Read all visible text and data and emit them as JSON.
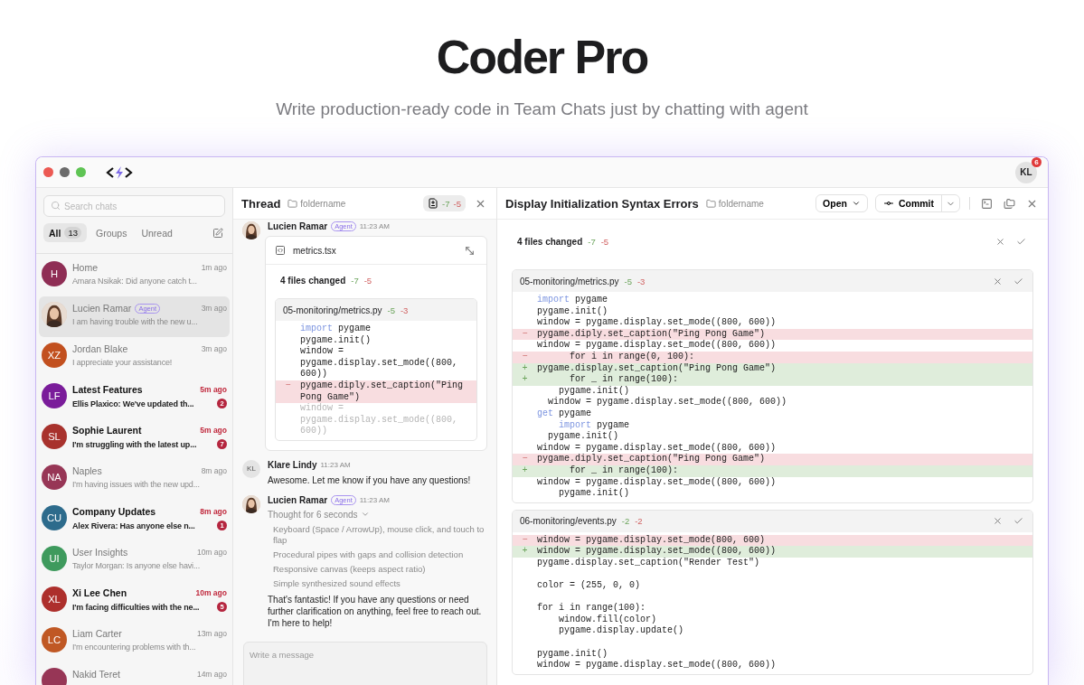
{
  "hero": {
    "title": "Coder Pro",
    "subtitle": "Write production-ready code in Team Chats just by chatting with agent"
  },
  "user": {
    "initials": "KL",
    "badge": "6"
  },
  "sidebar": {
    "search": {
      "placeholder": "Search chats"
    },
    "tabs": [
      {
        "label": "All",
        "count": "13",
        "selected": true
      },
      {
        "label": "Groups",
        "selected": false
      },
      {
        "label": "Unread",
        "selected": false
      }
    ],
    "chats": [
      {
        "name": "Home",
        "preview": "Amara Nsikak: Did anyone catch t...",
        "time": "1m ago",
        "unread": false,
        "selected": false,
        "avatar": {
          "kind": "initials",
          "initials": "H",
          "color": "#8f2e55"
        }
      },
      {
        "name": "Lucien Ramar",
        "tag": "Agent",
        "preview": "I am having trouble with the new u...",
        "time": "3m ago",
        "unread": false,
        "selected": true,
        "avatar": {
          "kind": "photo"
        }
      },
      {
        "name": "Jordan Blake",
        "preview": "I appreciate your assistance!",
        "time": "3m ago",
        "unread": false,
        "selected": false,
        "avatar": {
          "kind": "initials",
          "initials": "XZ",
          "color": "#c2501f"
        }
      },
      {
        "name": "Latest Features",
        "preview": "Ellis Plaxico: We've updated th...",
        "time": "5m ago",
        "unread": true,
        "badge": "2",
        "selected": false,
        "avatar": {
          "kind": "initials",
          "initials": "LF",
          "color": "#7a1c9a"
        }
      },
      {
        "name": "Sophie Laurent",
        "preview": "I'm struggling with the latest up...",
        "time": "5m ago",
        "unread": true,
        "badge": "7",
        "selected": false,
        "avatar": {
          "kind": "initials",
          "initials": "SL",
          "color": "#a8322d"
        }
      },
      {
        "name": "Naples",
        "preview": "I'm having issues with the new upd...",
        "time": "8m ago",
        "unread": false,
        "selected": false,
        "avatar": {
          "kind": "initials",
          "initials": "NA",
          "color": "#973656"
        }
      },
      {
        "name": "Company Updates",
        "preview": "Alex Rivera: Has anyone else n...",
        "time": "8m ago",
        "unread": true,
        "badge": "1",
        "selected": false,
        "avatar": {
          "kind": "initials",
          "initials": "CU",
          "color": "#2d6b8c"
        }
      },
      {
        "name": "User Insights",
        "preview": "Taylor Morgan: Is anyone else havi...",
        "time": "10m ago",
        "unread": false,
        "selected": false,
        "avatar": {
          "kind": "initials",
          "initials": "UI",
          "color": "#3e9a5d"
        }
      },
      {
        "name": "Xi Lee Chen",
        "preview": "I'm facing difficulties with the ne...",
        "time": "10m ago",
        "unread": true,
        "badge": "5",
        "selected": false,
        "avatar": {
          "kind": "initials",
          "initials": "XL",
          "color": "#ad2f2c"
        }
      },
      {
        "name": "Liam Carter",
        "preview": "I'm encountering problems with th...",
        "time": "13m ago",
        "unread": false,
        "selected": false,
        "avatar": {
          "kind": "initials",
          "initials": "LC",
          "color": "#c05824"
        }
      },
      {
        "name": "Nakid Teret",
        "time": "14m ago",
        "unread": false,
        "selected": false,
        "avatar": {
          "kind": "initials",
          "color": "#973656"
        }
      }
    ]
  },
  "thread": {
    "title": "Thread",
    "folder": "foldername",
    "added": "-7",
    "removed": "-5",
    "messages": [
      {
        "author": "Lucien Ramar",
        "tag": "Agent",
        "time": "11:23 AM",
        "avatar": {
          "kind": "photo"
        },
        "attachment": {
          "filename": "metrics.tsx",
          "summary": "4 files changed",
          "added": "-7",
          "removed": "-5",
          "file": {
            "path": "05-monitoring/metrics.py",
            "added": "-5",
            "removed": "-3",
            "lines": [
              {
                "kind": "context",
                "keyword": "import",
                "text": " pygame"
              },
              {
                "kind": "context",
                "text": "pygame.init()"
              },
              {
                "kind": "context",
                "text": "window = pygame.display.set_mode((800, 600))"
              },
              {
                "kind": "removed",
                "sign": "−",
                "text": "pygame.diply.set_caption(\"Ping Pong Game\")"
              },
              {
                "kind": "context",
                "text": "window = pygame.display.set_mode((800, 600))",
                "dimmed": true
              }
            ]
          }
        }
      },
      {
        "author": "Klare Lindy",
        "time": "11:23 AM",
        "avatar": {
          "kind": "initials",
          "initials": "KL",
          "color": "#e4e4e4"
        },
        "text": "Awesome. Let me know if you have any questions!"
      },
      {
        "author": "Lucien Ramar",
        "tag": "Agent",
        "time": "11:23 AM",
        "avatar": {
          "kind": "photo"
        },
        "thought": {
          "label": "Thought for 6 seconds",
          "expanded": true,
          "steps": [
            "Keyboard (Space / ArrowUp), mouse click, and touch to flap",
            "Procedural pipes with gaps and collision detection",
            "Responsive canvas (keeps aspect ratio)",
            "Simple synthesized sound effects"
          ]
        },
        "text": "That's fantastic! If you have any questions or need further clarification on anything, feel free to reach out. I'm here to help!"
      }
    ],
    "composer": {
      "placeholder": "Write a message"
    }
  },
  "review": {
    "title": "Display Initialization Syntax Errors",
    "folder": "foldername",
    "buttons": {
      "open": "Open",
      "commit": "Commit"
    },
    "summary": "4 files changed",
    "added": "-7",
    "removed": "-5",
    "files": [
      {
        "path": "05-monitoring/metrics.py",
        "added": "-5",
        "removed": "-3",
        "lines": [
          {
            "kind": "context",
            "keyword": "import",
            "text": " pygame"
          },
          {
            "kind": "context",
            "text": "pygame.init()"
          },
          {
            "kind": "context",
            "text": "window = pygame.display.set_mode((800, 600))"
          },
          {
            "kind": "removed",
            "sign": "−",
            "text": "pygame.diply.set_caption(\"Ping Pong Game\")"
          },
          {
            "kind": "context",
            "text": "window = pygame.display.set_mode((800, 600))"
          },
          {
            "kind": "removed",
            "sign": "−",
            "text": "      for i in range(0, 100):"
          },
          {
            "kind": "added",
            "sign": "+",
            "text": "pygame.display.set_caption(\"Ping Pong Game\")"
          },
          {
            "kind": "added",
            "sign": "+",
            "text": "      for _ in range(100):"
          },
          {
            "kind": "context",
            "text": "    pygame.init()"
          },
          {
            "kind": "context",
            "text": "  window = pygame.display.set_mode((800, 600))"
          },
          {
            "kind": "context",
            "keyword": "get",
            "text": " pygame"
          },
          {
            "kind": "context",
            "keyword": "    import",
            "text": " pygame"
          },
          {
            "kind": "context",
            "text": "  pygame.init()"
          },
          {
            "kind": "context",
            "text": "window = pygame.display.set_mode((800, 600))"
          },
          {
            "kind": "removed",
            "sign": "−",
            "text": "pygame.diply.set_caption(\"Ping Pong Game\")"
          },
          {
            "kind": "added",
            "sign": "+",
            "text": "      for _ in range(100):"
          },
          {
            "kind": "context",
            "text": "window = pygame.display.set_mode((800, 600))"
          },
          {
            "kind": "context",
            "text": "    pygame.init()"
          }
        ]
      },
      {
        "path": "06-monitoring/events.py",
        "added": "-2",
        "removed": "-2",
        "lines": [
          {
            "kind": "removed",
            "sign": "−",
            "text": "window = pygame.display.set_mode(800, 600)"
          },
          {
            "kind": "added",
            "sign": "+",
            "text": "window = pygame.display.set_mode((800, 600))"
          },
          {
            "kind": "context",
            "text": "pygame.display.set_caption(\"Render Test\")"
          },
          {
            "kind": "blank"
          },
          {
            "kind": "context",
            "text": "color = (255, 0, 0)"
          },
          {
            "kind": "blank"
          },
          {
            "kind": "context",
            "text": "for i in range(100):"
          },
          {
            "kind": "context",
            "text": "    window.fill(color)"
          },
          {
            "kind": "context",
            "text": "    pygame.display.update()"
          },
          {
            "kind": "blank"
          },
          {
            "kind": "context",
            "text": "pygame.init()"
          },
          {
            "kind": "context",
            "text": "window = pygame.display.set_mode((800, 600))"
          }
        ]
      }
    ]
  }
}
